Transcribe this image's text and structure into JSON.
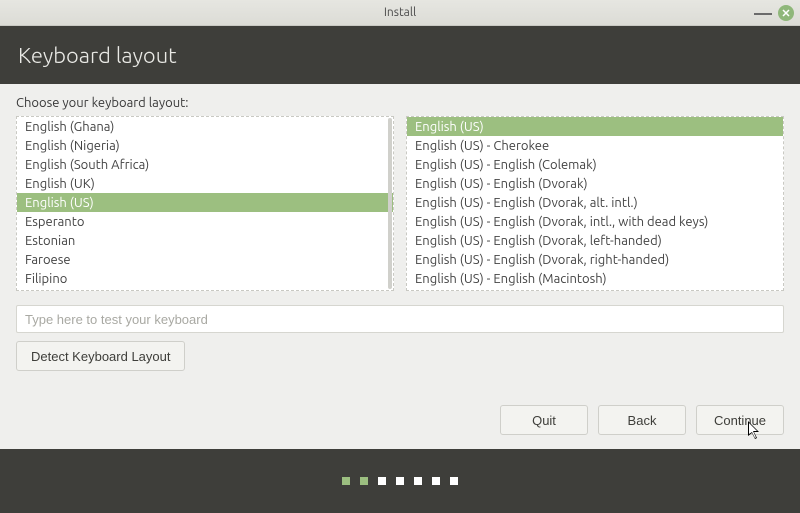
{
  "window": {
    "title": "Install"
  },
  "header": {
    "title": "Keyboard layout"
  },
  "choose_label": "Choose your keyboard layout:",
  "left_list": {
    "items": [
      {
        "label": "English (Ghana)",
        "selected": false
      },
      {
        "label": "English (Nigeria)",
        "selected": false
      },
      {
        "label": "English (South Africa)",
        "selected": false
      },
      {
        "label": "English (UK)",
        "selected": false
      },
      {
        "label": "English (US)",
        "selected": true
      },
      {
        "label": "Esperanto",
        "selected": false
      },
      {
        "label": "Estonian",
        "selected": false
      },
      {
        "label": "Faroese",
        "selected": false
      },
      {
        "label": "Filipino",
        "selected": false
      }
    ]
  },
  "right_list": {
    "items": [
      {
        "label": "English (US)",
        "selected": true
      },
      {
        "label": "English (US) - Cherokee",
        "selected": false
      },
      {
        "label": "English (US) - English (Colemak)",
        "selected": false
      },
      {
        "label": "English (US) - English (Dvorak)",
        "selected": false
      },
      {
        "label": "English (US) - English (Dvorak, alt. intl.)",
        "selected": false
      },
      {
        "label": "English (US) - English (Dvorak, intl., with dead keys)",
        "selected": false
      },
      {
        "label": "English (US) - English (Dvorak, left-handed)",
        "selected": false
      },
      {
        "label": "English (US) - English (Dvorak, right-handed)",
        "selected": false
      },
      {
        "label": "English (US) - English (Macintosh)",
        "selected": false
      }
    ]
  },
  "test_input": {
    "placeholder": "Type here to test your keyboard",
    "value": ""
  },
  "buttons": {
    "detect": "Detect Keyboard Layout",
    "quit": "Quit",
    "back": "Back",
    "continue": "Continue"
  },
  "progress": {
    "total": 7,
    "current": 2
  },
  "colors": {
    "accent": "#9cbf80",
    "header_bg": "#3e3e3a",
    "content_bg": "#efefed"
  }
}
